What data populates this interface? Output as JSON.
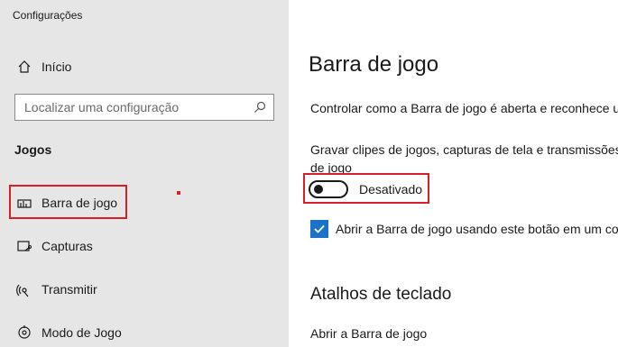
{
  "app": {
    "title": "Configurações"
  },
  "sidebar": {
    "home_label": "Início",
    "search_placeholder": "Localizar uma configuração",
    "section_title": "Jogos",
    "items": [
      {
        "label": "Barra de jogo",
        "icon": "game-bar-icon",
        "selected": true
      },
      {
        "label": "Capturas",
        "icon": "captures-icon"
      },
      {
        "label": "Transmitir",
        "icon": "broadcast-icon"
      },
      {
        "label": "Modo de Jogo",
        "icon": "game-mode-icon"
      }
    ]
  },
  "main": {
    "title": "Barra de jogo",
    "description": "Controlar como a Barra de jogo é aberta e reconhece u",
    "record_label_line1": "Gravar clipes de jogos, capturas de tela e transmissões u",
    "record_label_line2": "de jogo",
    "toggle": {
      "state": "off",
      "state_label": "Desativado"
    },
    "checkbox": {
      "checked": true,
      "label": "Abrir a Barra de jogo usando este botão em um co"
    },
    "shortcuts_title": "Atalhos de teclado",
    "shortcut_item": "Abrir a Barra de jogo"
  },
  "colors": {
    "sidebar_bg": "#e6e6e6",
    "accent": "#1a73c8",
    "highlight": "#d61f2a"
  }
}
